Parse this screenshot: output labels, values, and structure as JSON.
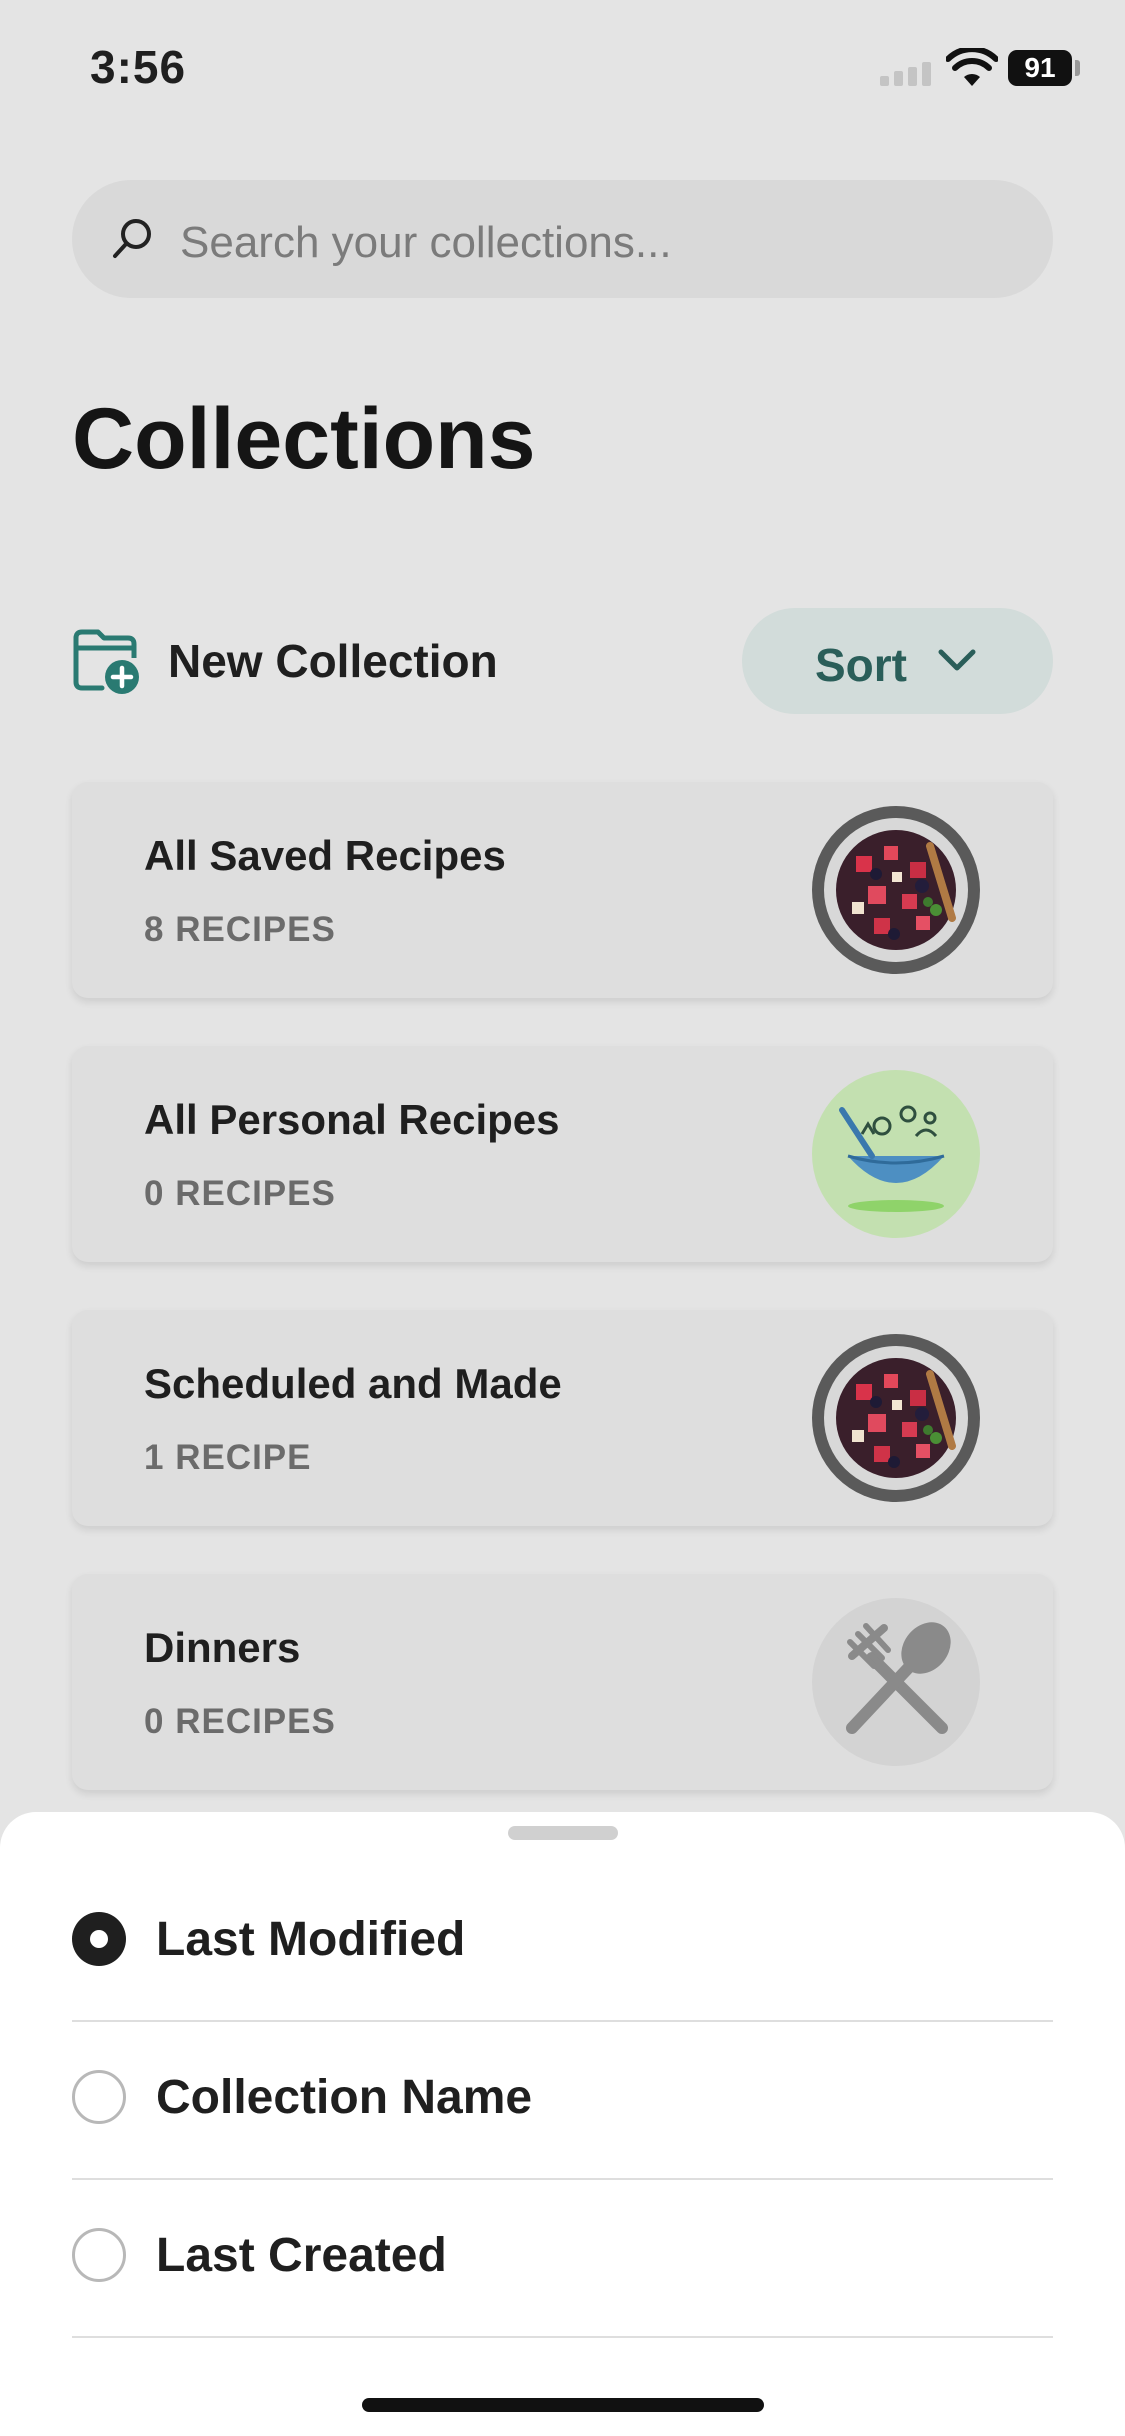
{
  "status": {
    "time": "3:56",
    "battery": "91"
  },
  "search": {
    "placeholder": "Search your collections..."
  },
  "page": {
    "title": "Collections"
  },
  "toolbar": {
    "new_collection_label": "New Collection",
    "sort_label": "Sort"
  },
  "collections": [
    {
      "name": "All Saved Recipes",
      "count": "8 RECIPES",
      "thumbnail": "fruit-salad-bowl"
    },
    {
      "name": "All Personal Recipes",
      "count": "0 RECIPES",
      "thumbnail": "green-cooking-illustration"
    },
    {
      "name": "Scheduled and Made",
      "count": "1 RECIPE",
      "thumbnail": "fruit-salad-bowl"
    },
    {
      "name": "Dinners",
      "count": "0 RECIPES",
      "thumbnail": "fork-spoon-placeholder"
    }
  ],
  "sort_sheet": {
    "options": [
      {
        "label": "Last Modified",
        "selected": true
      },
      {
        "label": "Collection Name",
        "selected": false
      },
      {
        "label": "Last Created",
        "selected": false
      }
    ]
  },
  "colors": {
    "accent": "#2a5e59",
    "sort_button_bg": "#d2dcda",
    "background": "#e4e4e4"
  }
}
